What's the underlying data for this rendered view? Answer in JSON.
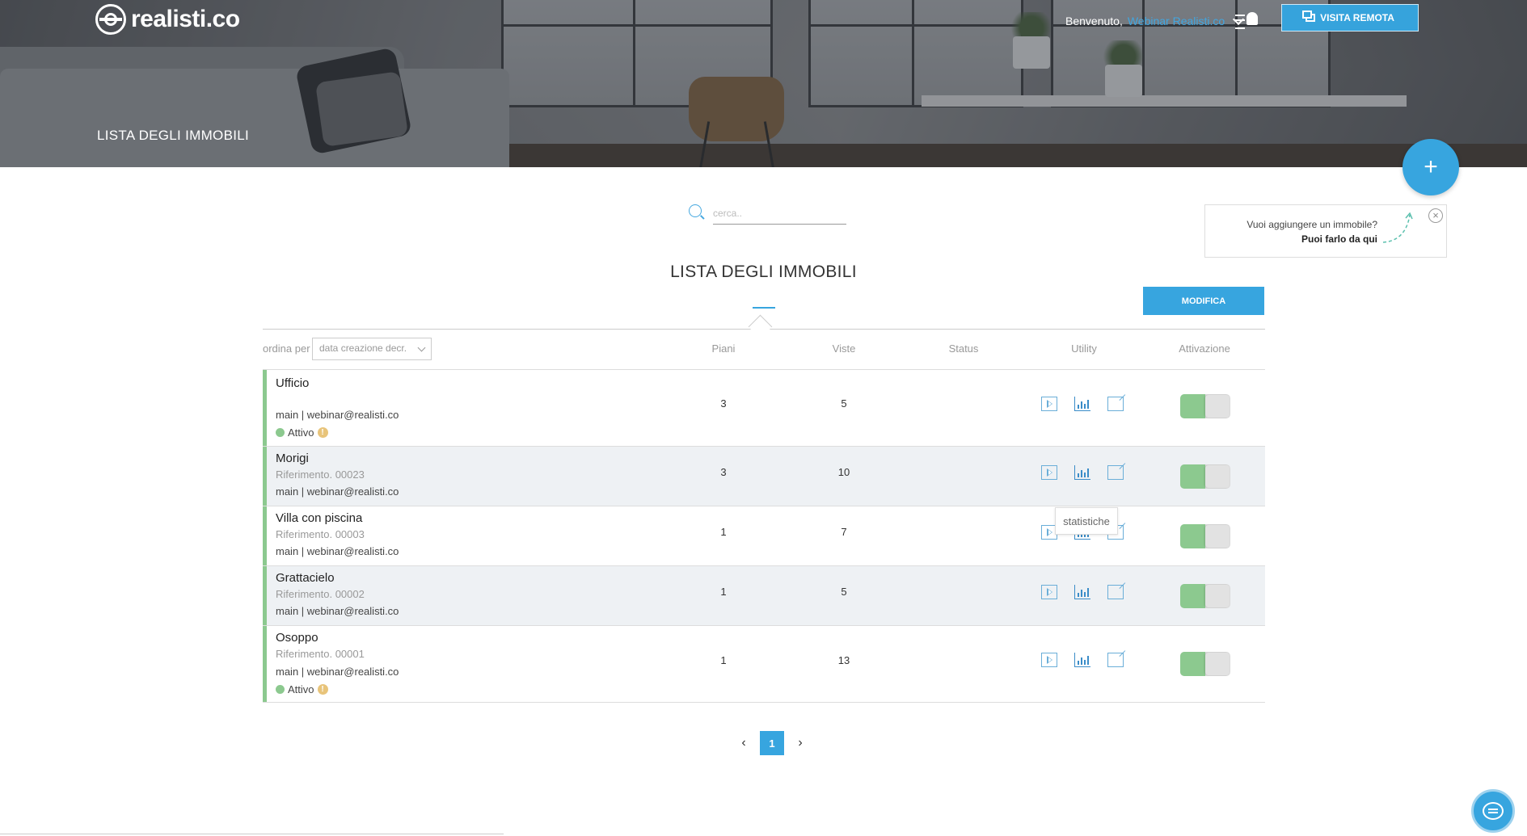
{
  "header": {
    "logo_text": "realisti.co",
    "hero_title": "LISTA DEGLI IMMOBILI",
    "welcome_prefix": "Benvenuto,",
    "user_name": "Webinar Realisti.co",
    "remote_visit_label": "VISITA REMOTA",
    "accent_color": "#37a5df"
  },
  "add_button": {
    "label": "+"
  },
  "hint": {
    "question": "Vuoi aggiungere un immobile?",
    "answer": "Puoi farlo da qui",
    "close_label": "×"
  },
  "search": {
    "placeholder": "cerca.."
  },
  "main": {
    "title": "LISTA DEGLI IMMOBILI",
    "edit_button": "MODIFICA"
  },
  "table": {
    "sort_label": "ordina per",
    "sort_value": "data creazione decr.",
    "columns": [
      "Piani",
      "Viste",
      "Status",
      "Utility",
      "Attivazione"
    ],
    "rows": [
      {
        "name": "Ufficio",
        "reference": "",
        "owner": "main | webinar@realisti.co",
        "status": "Attivo",
        "piani": "3",
        "viste": "5",
        "active": true
      },
      {
        "name": "Morigi",
        "reference": "Riferimento. 00023",
        "owner": "main | webinar@realisti.co",
        "status": "",
        "piani": "3",
        "viste": "10",
        "active": true
      },
      {
        "name": "Villa con piscina",
        "reference": "Riferimento. 00003",
        "owner": "main | webinar@realisti.co",
        "status": "",
        "piani": "1",
        "viste": "7",
        "active": true
      },
      {
        "name": "Grattacielo",
        "reference": "Riferimento. 00002",
        "owner": "main | webinar@realisti.co",
        "status": "",
        "piani": "1",
        "viste": "5",
        "active": true
      },
      {
        "name": "Osoppo",
        "reference": "Riferimento. 00001",
        "owner": "main | webinar@realisti.co",
        "status": "Attivo",
        "piani": "1",
        "viste": "13",
        "active": true
      }
    ],
    "tooltip": "statistiche"
  },
  "pagination": {
    "current": "1",
    "prev": "‹",
    "next": "›"
  },
  "icons": [
    "play-icon",
    "statistics-icon",
    "external-link-icon",
    "search-icon",
    "bell-icon",
    "chat-icon"
  ]
}
